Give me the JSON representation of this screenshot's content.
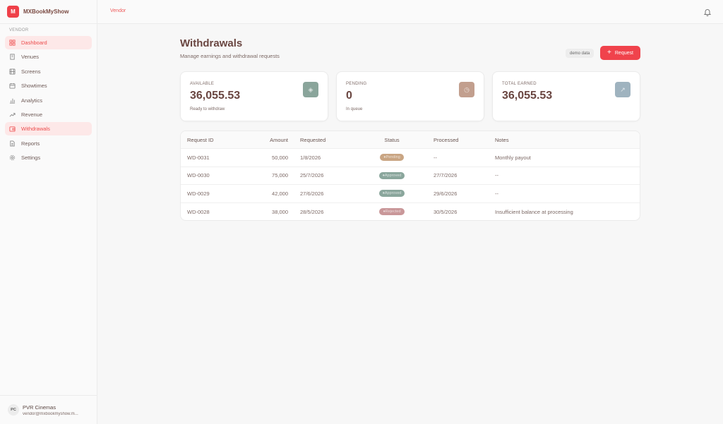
{
  "app": {
    "brand_initial": "M",
    "brand_name": "MXBookMyShow"
  },
  "sidebar": {
    "section_label": "VENDOR",
    "items": [
      {
        "label": "Dashboard",
        "icon": "grid-icon",
        "active": true
      },
      {
        "label": "Venues",
        "icon": "building-icon",
        "active": false
      },
      {
        "label": "Screens",
        "icon": "film-icon",
        "active": false
      },
      {
        "label": "Showtimes",
        "icon": "calendar-icon",
        "active": false
      },
      {
        "label": "Analytics",
        "icon": "bar-chart-icon",
        "active": false
      },
      {
        "label": "Revenue",
        "icon": "trending-up-icon",
        "active": false
      },
      {
        "label": "Withdrawals",
        "icon": "wallet-icon",
        "active": true
      },
      {
        "label": "Reports",
        "icon": "file-icon",
        "active": false
      },
      {
        "label": "Settings",
        "icon": "gear-icon",
        "active": false
      }
    ],
    "user": {
      "initials": "PC",
      "name": "PVR Cinemas",
      "email": "vendor@mxbookmyshow.m..."
    }
  },
  "topbar": {
    "breadcrumb": "Vendor",
    "bell_icon": "bell-icon"
  },
  "page": {
    "title": "Withdrawals",
    "subtitle": "Manage earnings and withdrawal requests",
    "demo_badge": "demo data",
    "request_button": "Request",
    "request_button_icon": "+"
  },
  "stats": [
    {
      "label": "AVAILABLE",
      "value": "36,055.53",
      "sub": "Ready to withdraw",
      "icon_color": "#8aa59b"
    },
    {
      "label": "PENDING",
      "value": "0",
      "sub": "In queue",
      "icon_color": "#c29f8e"
    },
    {
      "label": "TOTAL EARNED",
      "value": "36,055.53",
      "sub": "",
      "icon_color": "#9fb3bf"
    }
  ],
  "table": {
    "columns": [
      "Request ID",
      "Amount",
      "Requested",
      "Status",
      "Processed",
      "Notes"
    ],
    "rows": [
      {
        "id": "WD-0031",
        "amount": "50,000",
        "requested": "1/8/2026",
        "status": "Pending",
        "status_color": "#c9a583",
        "processed": "--",
        "notes": "Monthly payout"
      },
      {
        "id": "WD-0030",
        "amount": "75,000",
        "requested": "25/7/2026",
        "status": "Approved",
        "status_color": "#8aa69c",
        "processed": "27/7/2026",
        "notes": "--"
      },
      {
        "id": "WD-0029",
        "amount": "42,000",
        "requested": "27/6/2026",
        "status": "Approved",
        "status_color": "#8aa69c",
        "processed": "29/6/2026",
        "notes": "--"
      },
      {
        "id": "WD-0028",
        "amount": "38,000",
        "requested": "28/5/2026",
        "status": "Rejected",
        "status_color": "#c99799",
        "processed": "30/5/2026",
        "notes": "Insufficient balance at processing"
      }
    ]
  }
}
